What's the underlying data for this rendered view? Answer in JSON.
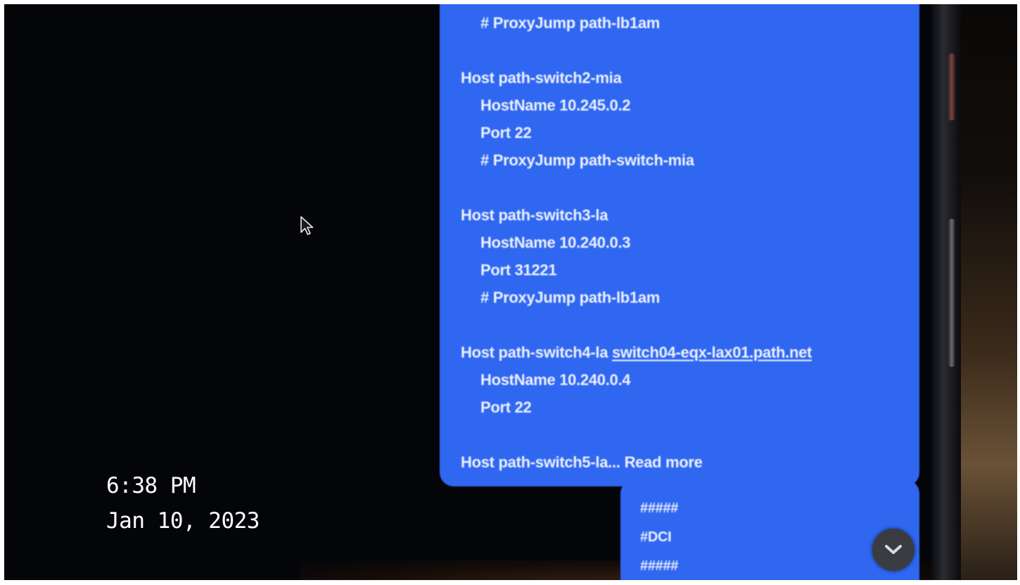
{
  "message_main": {
    "lines": [
      "# ProxyJump path-lb1am",
      "Host path-switch2-mia",
      "HostName 10.245.0.2",
      "Port 22",
      "# ProxyJump path-switch-mia",
      "Host path-switch3-la",
      "HostName 10.240.0.3",
      "Port 31221",
      "# ProxyJump path-lb1am",
      "Host path-switch4-la",
      "HostName 10.240.0.4",
      "Port 22",
      "Host path-switch5-la..."
    ],
    "link_text": "switch04-eqx-lax01.path.net",
    "read_more_label": "Read more"
  },
  "message_second": {
    "lines": [
      "#####",
      "#DCI",
      "#####"
    ]
  },
  "overlay": {
    "time": "6:38 PM",
    "date": "Jan 10, 2023"
  },
  "icons": {
    "cursor": "mouse-pointer-icon",
    "scroll_down": "chevron-down-icon"
  },
  "colors": {
    "bubble_blue": "#2f67f1",
    "background": "#040508",
    "bubble_text": "#eef2ff"
  }
}
